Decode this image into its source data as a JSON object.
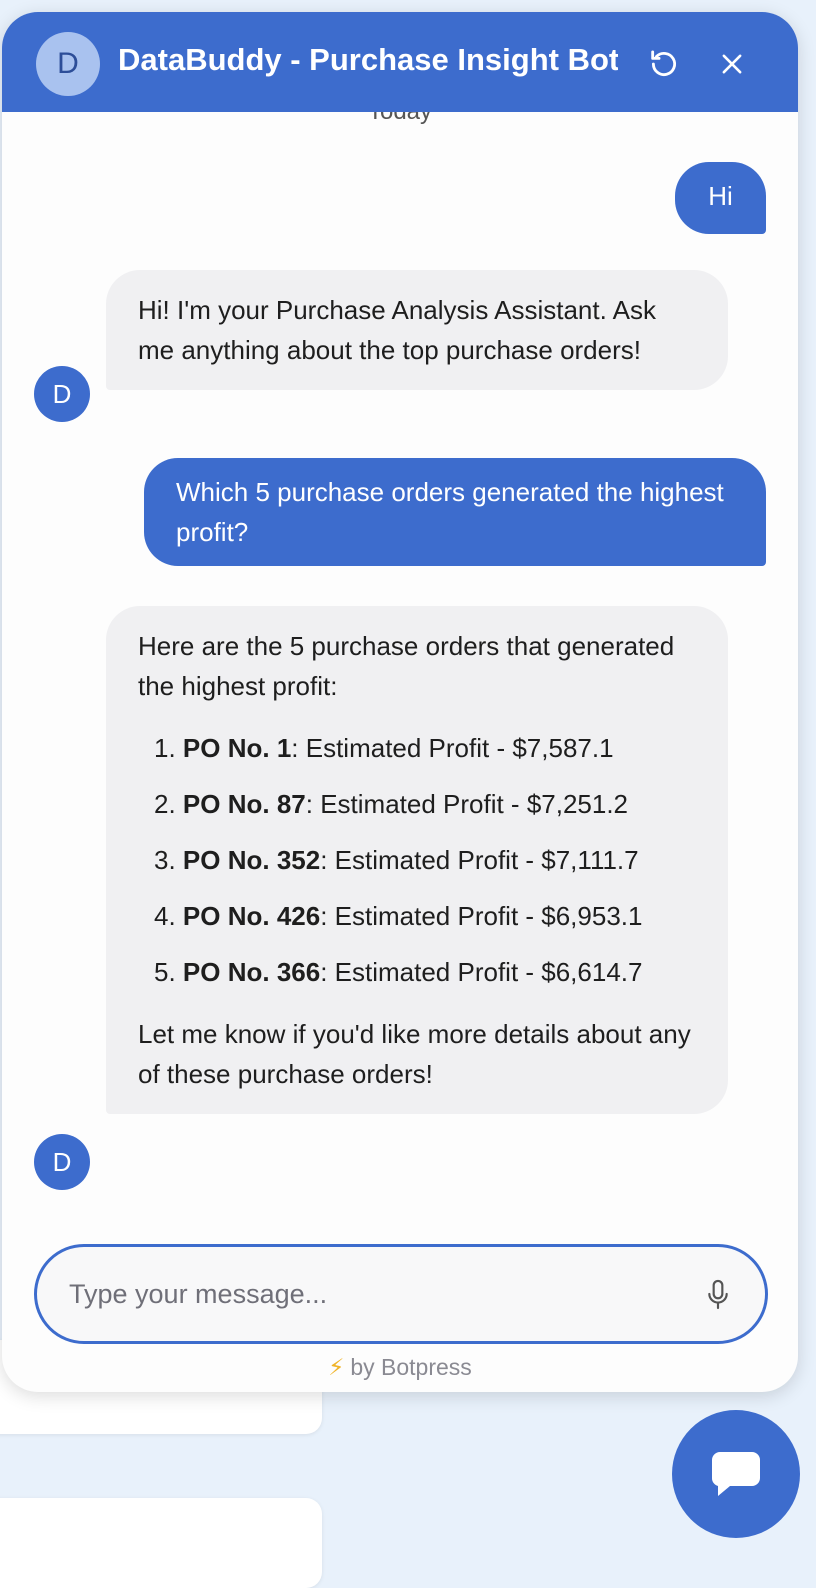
{
  "header": {
    "avatar_letter": "D",
    "title": "DataBuddy - Purchase Insight Bot"
  },
  "date_separator": "Today",
  "messages": [
    {
      "role": "user",
      "text": "Hi"
    },
    {
      "role": "bot",
      "avatar": "D",
      "text": "Hi! I'm your Purchase Analysis Assistant. Ask me anything about the top purchase orders!"
    },
    {
      "role": "user",
      "text": "Which 5 purchase orders generated the highest profit?"
    },
    {
      "role": "bot",
      "avatar": "D",
      "intro": "Here are the 5 purchase orders that generated the highest profit:",
      "items": [
        {
          "num": "1.",
          "po": "PO No. 1",
          "text": ": Estimated Profit - $7,587.1"
        },
        {
          "num": "2.",
          "po": "PO No. 87",
          "text": ": Estimated Profit - $7,251.2"
        },
        {
          "num": "3.",
          "po": "PO No. 352",
          "text": ": Estimated Profit - $7,111.7"
        },
        {
          "num": "4.",
          "po": "PO No. 426",
          "text": ": Estimated Profit - $6,953.1"
        },
        {
          "num": "5.",
          "po": "PO No. 366",
          "text": ": Estimated Profit - $6,614.7"
        }
      ],
      "outro": "Let me know if you'd like more details about any of these purchase orders!"
    }
  ],
  "composer": {
    "placeholder": "Type your message..."
  },
  "footer": {
    "bolt": "⚡",
    "text": "by Botpress"
  },
  "colors": {
    "accent": "#3d6ccd",
    "bot_bubble": "#f0f0f2",
    "page_bg": "#e8f1fb"
  },
  "icons": [
    "refresh-icon",
    "close-icon",
    "microphone-icon",
    "chat-bubble-icon"
  ]
}
